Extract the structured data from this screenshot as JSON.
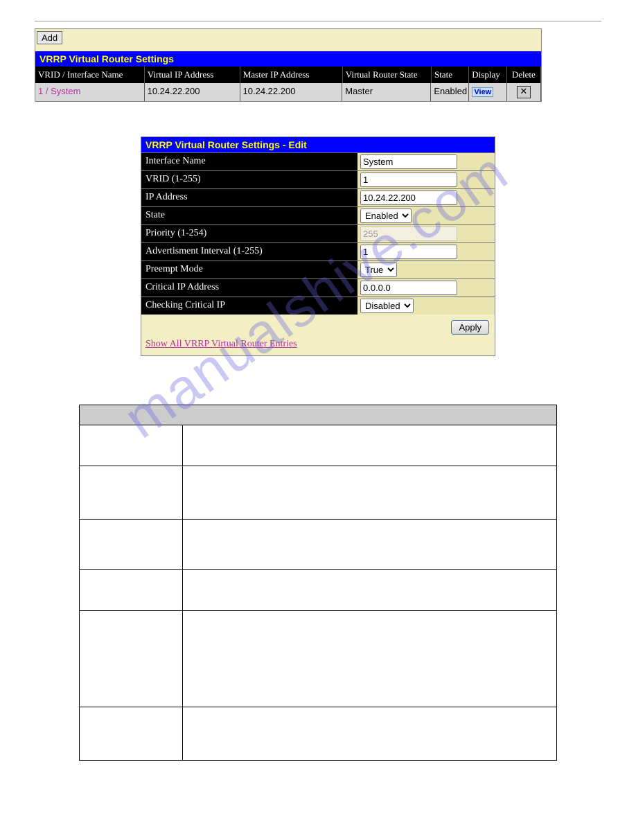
{
  "watermark": "manualshive.com",
  "panel1": {
    "add_label": "Add",
    "title": "VRRP Virtual Router Settings",
    "headers": {
      "vrid": "VRID / Interface Name",
      "vip": "Virtual IP  Address",
      "mip": "Master IP Address",
      "vrs": "Virtual Router State",
      "state": "State",
      "display": "Display",
      "delete": "Delete"
    },
    "row": {
      "vrid": "1 / System",
      "vip": "10.24.22.200",
      "mip": "10.24.22.200",
      "vrs": "Master",
      "state": "Enabled",
      "view": "View",
      "del": "✕"
    }
  },
  "panel2": {
    "title": "VRRP Virtual Router Settings - Edit",
    "rows": {
      "ifname_label": "Interface Name",
      "ifname_value": "System",
      "vrid_label": "VRID (1-255)",
      "vrid_value": "1",
      "ip_label": "IP Address",
      "ip_value": "10.24.22.200",
      "state_label": "State",
      "state_value": "Enabled",
      "prio_label": "Priority (1-254)",
      "prio_value": "255",
      "adv_label": "Advertisment Interval (1-255)",
      "adv_value": "1",
      "preempt_label": "Preempt Mode",
      "preempt_value": "True",
      "crit_label": "Critical IP Address",
      "crit_value": "0.0.0.0",
      "check_label": "Checking Critical IP",
      "check_value": "Disabled"
    },
    "apply": "Apply",
    "show_link": "Show All VRRP Virtual Router Entries"
  },
  "param_rows": [
    {
      "h": 50
    },
    {
      "h": 68
    },
    {
      "h": 64
    },
    {
      "h": 50
    },
    {
      "h": 130
    },
    {
      "h": 68
    }
  ]
}
